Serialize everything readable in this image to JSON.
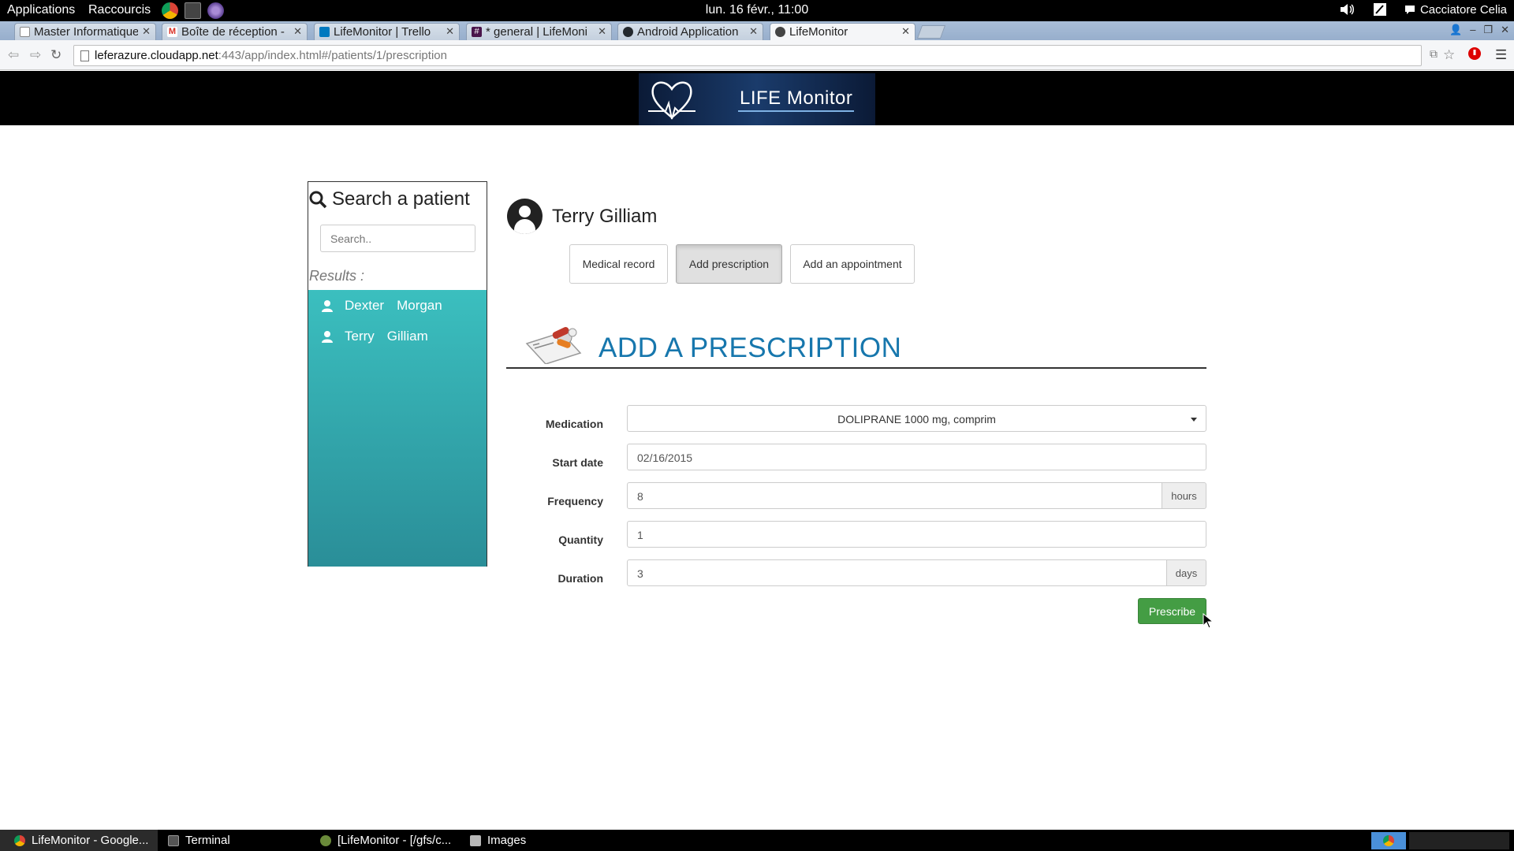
{
  "topbar": {
    "applications": "Applications",
    "shortcuts": "Raccourcis",
    "clock": "lun. 16 févr., 11:00",
    "user": "Cacciatore Celia"
  },
  "tabs": [
    {
      "label": "Master Informatique",
      "favicon_color": "#ffffff"
    },
    {
      "label": "Boîte de réception -",
      "favicon_color": "#d93025"
    },
    {
      "label": "LifeMonitor | Trello",
      "favicon_color": "#0079bf"
    },
    {
      "label": "* general | LifeMoni",
      "favicon_color": "#4a154b"
    },
    {
      "label": "Android Application",
      "favicon_color": "#24292e"
    },
    {
      "label": "LifeMonitor",
      "favicon_color": "#444444"
    }
  ],
  "address": {
    "host": "leferazure.cloudapp.net",
    "rest": ":443/app/index.html#/patients/1/prescription"
  },
  "banner": {
    "logo_text": "LIFE Monitor"
  },
  "sidebar": {
    "title": "Search a patient",
    "search_placeholder": "Search..",
    "results_label": "Results :",
    "results": [
      {
        "first": "Dexter",
        "last": "Morgan"
      },
      {
        "first": "Terry",
        "last": "Gilliam"
      }
    ]
  },
  "patient": {
    "name": "Terry Gilliam"
  },
  "actions": {
    "medical_record": "Medical record",
    "add_prescription": "Add prescription",
    "add_appointment": "Add an appointment"
  },
  "section": {
    "heading": "ADD A PRESCRIPTION"
  },
  "form": {
    "medication": {
      "label": "Medication",
      "value": "DOLIPRANE 1000 mg, comprim"
    },
    "start_date": {
      "label": "Start date",
      "value": "02/16/2015"
    },
    "frequency": {
      "label": "Frequency",
      "value": "8",
      "unit": "hours"
    },
    "quantity": {
      "label": "Quantity",
      "value": "1"
    },
    "duration": {
      "label": "Duration",
      "value": "3",
      "unit": "days"
    },
    "submit": "Prescribe"
  },
  "taskbar": [
    {
      "label": "LifeMonitor - Google...",
      "icon_color": "#dd4b39"
    },
    {
      "label": "Terminal",
      "icon_color": "#555555"
    },
    {
      "label": "[LifeMonitor - [/gfs/c...",
      "icon_color": "#6a8a3a"
    },
    {
      "label": "Images",
      "icon_color": "#b8b8b8"
    }
  ],
  "colors": {
    "accent": "#1777ad",
    "results_top": "#3bbfbf",
    "results_bottom": "#2a8e98",
    "prescribe": "#449d44"
  }
}
